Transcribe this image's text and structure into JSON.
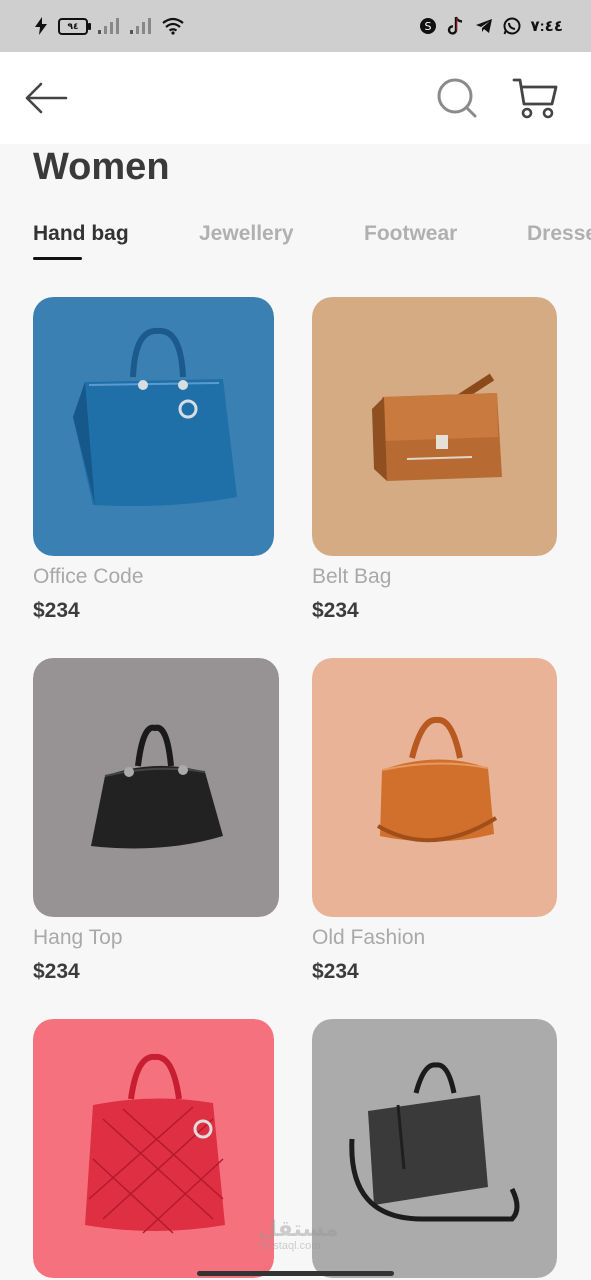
{
  "status_bar": {
    "battery_level": "٩٤",
    "time": "٧:٤٤"
  },
  "header": {
    "back_icon": "arrow-left-icon",
    "search_icon": "search-icon",
    "cart_icon": "cart-icon"
  },
  "page": {
    "title": "Women"
  },
  "tabs": [
    {
      "label": "Hand bag",
      "active": true
    },
    {
      "label": "Jewellery",
      "active": false
    },
    {
      "label": "Footwear",
      "active": false
    },
    {
      "label": "Dresses",
      "active": false
    }
  ],
  "products": [
    {
      "name": "Office Code",
      "price": "$234",
      "bg_color": "#3a80b2",
      "image": "blue-handbag"
    },
    {
      "name": "Belt Bag",
      "price": "$234",
      "bg_color": "#d5ab84",
      "image": "brown-messenger-bag"
    },
    {
      "name": "Hang Top",
      "price": "$234",
      "bg_color": "#979394",
      "image": "black-handbag"
    },
    {
      "name": "Old Fashion",
      "price": "$234",
      "bg_color": "#e9b398",
      "image": "orange-duffel-bag"
    },
    {
      "name": "",
      "price": "",
      "bg_color": "#f6717e",
      "image": "red-quilted-handbag"
    },
    {
      "name": "",
      "price": "",
      "bg_color": "#ababab",
      "image": "grey-laptop-bag"
    }
  ],
  "watermark": {
    "text": "مستقل",
    "sub": "mostaql.com"
  }
}
